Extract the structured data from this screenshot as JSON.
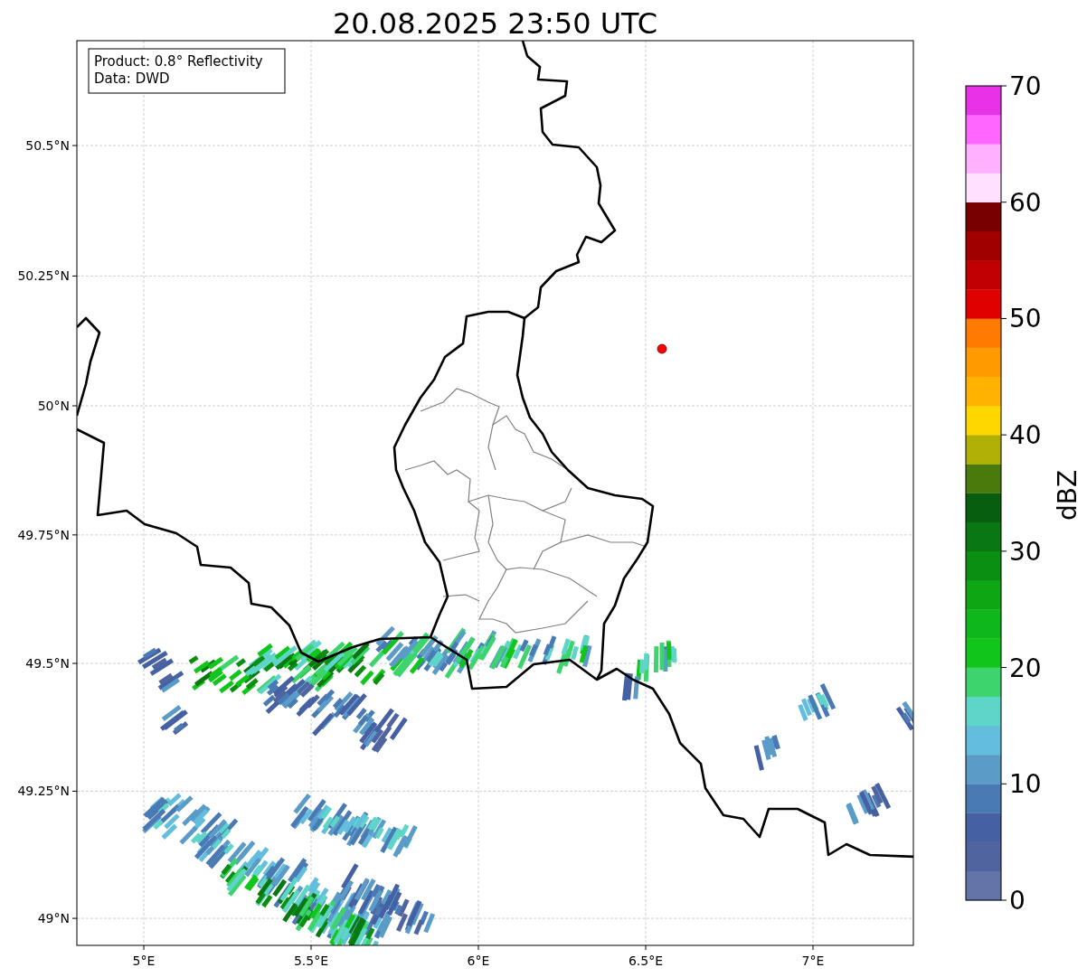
{
  "title": "20.08.2025 23:50 UTC",
  "info_box": [
    "Product: 0.8° Reflectivity",
    "Data: DWD"
  ],
  "map": {
    "yticks": [
      "50.5°N",
      "50.25°N",
      "50°N",
      "49.75°N",
      "49.5°N",
      "49.25°N",
      "49°N"
    ],
    "xticks": [
      "5°E",
      "5.5°E",
      "6°E",
      "6.5°E",
      "7°E"
    ]
  },
  "colorbar": {
    "label": "dBZ",
    "ticks": [
      "70",
      "60",
      "50",
      "40",
      "30",
      "20",
      "10",
      "0"
    ],
    "segments": [
      {
        "color": "#6574a8"
      },
      {
        "color": "#5064a0"
      },
      {
        "color": "#4560a3"
      },
      {
        "color": "#4a7ab4"
      },
      {
        "color": "#5a9bc8"
      },
      {
        "color": "#63bede"
      },
      {
        "color": "#5ed5c8"
      },
      {
        "color": "#3dd46e"
      },
      {
        "color": "#11c61b"
      },
      {
        "color": "#0fb81a"
      },
      {
        "color": "#0ea612"
      },
      {
        "color": "#0b8f12"
      },
      {
        "color": "#0a7812"
      },
      {
        "color": "#075e0f"
      },
      {
        "color": "#4a7a0c"
      },
      {
        "color": "#b0b005"
      },
      {
        "color": "#ffd700"
      },
      {
        "color": "#ffb300"
      },
      {
        "color": "#ff9a00"
      },
      {
        "color": "#ff7b00"
      },
      {
        "color": "#e00000"
      },
      {
        "color": "#c00000"
      },
      {
        "color": "#a00000"
      },
      {
        "color": "#780000"
      },
      {
        "color": "#ffe0ff"
      },
      {
        "color": "#ffb0ff"
      },
      {
        "color": "#ff66ff"
      },
      {
        "color": "#e832e8"
      }
    ]
  }
}
